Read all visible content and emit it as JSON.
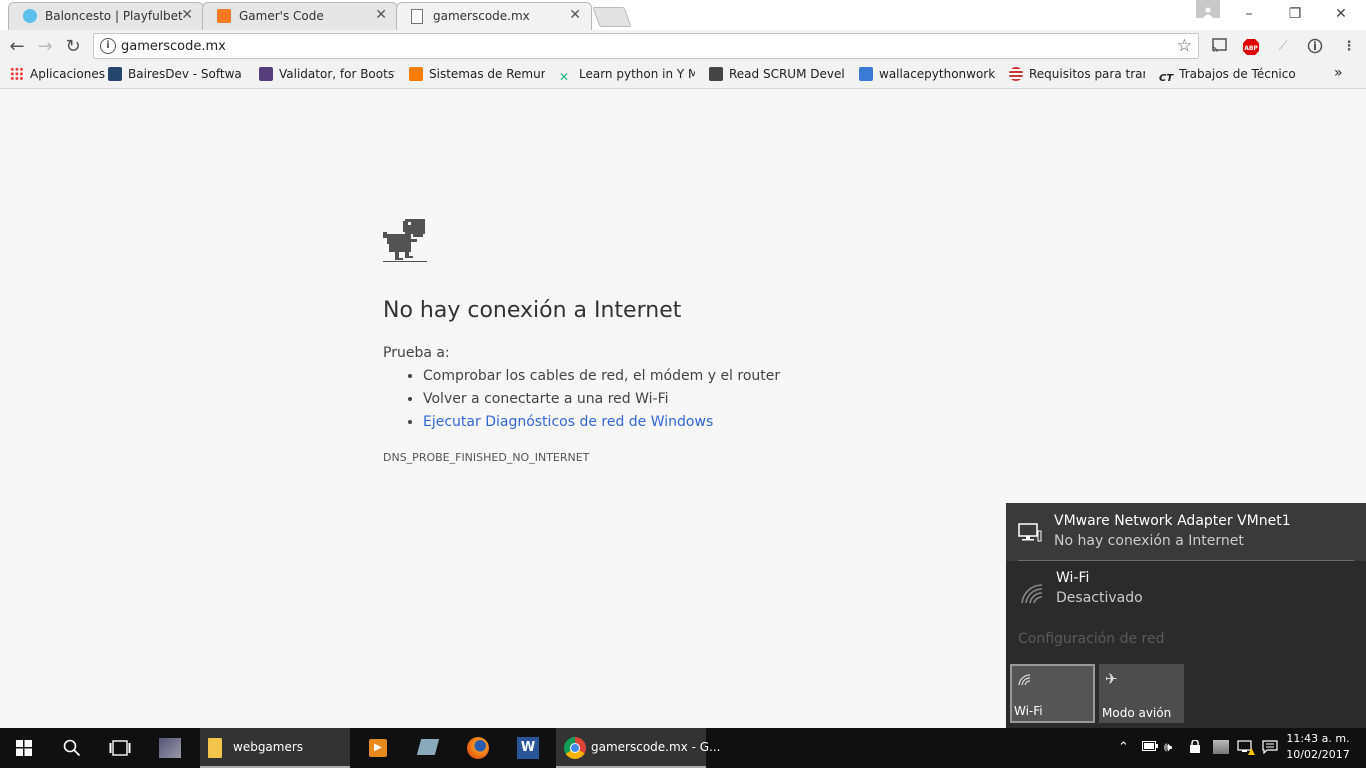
{
  "tabs": [
    {
      "title": "Baloncesto | Playfulbet",
      "favicon": "playfulbet-icon"
    },
    {
      "title": "Gamer's Code",
      "favicon": "xampp-icon"
    },
    {
      "title": "gamerscode.mx",
      "favicon": "page-icon",
      "active": true
    }
  ],
  "tab_close": "✕",
  "omnibox": {
    "url": "gamerscode.mx"
  },
  "bookmarks": {
    "apps": "Aplicaciones",
    "items": [
      "BairesDev - Software C",
      "Validator, for Bootstra",
      "Sistemas de Remuner",
      "Learn python in Y Min",
      "Read SCRUM Develop",
      "wallacepythonworksp",
      "Requisitos para tramit",
      "Trabajos de Técnico sc"
    ],
    "more": "»"
  },
  "error": {
    "title": "No hay conexión a Internet",
    "try_label": "Prueba a:",
    "suggestions": [
      "Comprobar los cables de red, el módem y el router",
      "Volver a conectarte a una red Wi-Fi"
    ],
    "link": "Ejecutar Diagnósticos de red de Windows",
    "code": "DNS_PROBE_FINISHED_NO_INTERNET"
  },
  "network": {
    "adapter_name": "VMware Network Adapter VMnet1",
    "adapter_status": "No hay conexión a Internet",
    "wifi_name": "Wi-Fi",
    "wifi_status": "Desactivado",
    "settings": "Configuración de red",
    "quick_wifi": "Wi-Fi",
    "quick_airplane": "Modo avión"
  },
  "taskbar": {
    "folder_label": "webgamers",
    "chrome_label": "gamerscode.mx - G...",
    "time": "11:43 a. m.",
    "date": "10/02/2017"
  },
  "colors": {
    "link": "#3367d6",
    "flyout_bg": "#2b2b2b",
    "taskbar_bg": "#101010"
  }
}
